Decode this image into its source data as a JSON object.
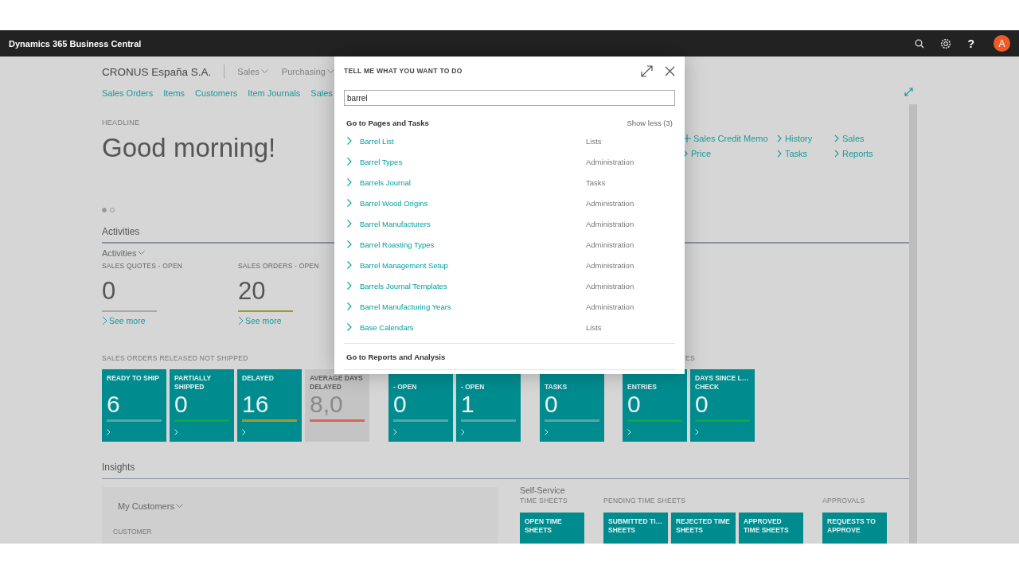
{
  "topbar": {
    "title": "Dynamics 365 Business Central",
    "avatar": "A",
    "help": "?"
  },
  "company": "CRONUS España S.A.",
  "nav_menus": [
    {
      "label": "Sales"
    },
    {
      "label": "Purchasing"
    }
  ],
  "nav_links": [
    "Sales Orders",
    "Items",
    "Customers",
    "Item Journals",
    "Sales"
  ],
  "headline": {
    "label": "HEADLINE",
    "greeting": "Good morning!"
  },
  "actions": [
    {
      "label": "Sales Credit Memo",
      "kind": "new"
    },
    {
      "label": "History",
      "kind": "open"
    },
    {
      "label": "Sales",
      "kind": "open"
    },
    {
      "label": "Price",
      "kind": "open"
    },
    {
      "label": "Tasks",
      "kind": "open"
    },
    {
      "label": "Reports",
      "kind": "open"
    }
  ],
  "pager": [
    {
      "selected": true
    },
    {
      "selected": false
    }
  ],
  "activities": {
    "title": "Activities",
    "dropdown": "Activities",
    "cues": [
      {
        "title": "SALES QUOTES - OPEN",
        "value": "0",
        "link": "See more",
        "color": "#a8a8a8"
      },
      {
        "title": "SALES ORDERS - OPEN",
        "value": "20",
        "link": "See more",
        "color": "#a39a2f"
      }
    ]
  },
  "tile_groups": [
    {
      "heading": "SALES ORDERS RELEASED NOT SHIPPED",
      "tiles": [
        {
          "title": "READY TO SHIP",
          "value": "6",
          "color": "#5aa5a5",
          "kind": "cue"
        },
        {
          "title": "PARTIALLY SHIPPED",
          "value": "0",
          "color": "#17a346",
          "kind": "cue"
        },
        {
          "title": "DELAYED",
          "value": "16",
          "color": "#a39a2f",
          "kind": "cue"
        },
        {
          "title": "AVERAGE DAYS DELAYED",
          "value": "8,0",
          "color": "#d9645a",
          "kind": "muted"
        }
      ]
    },
    {
      "tiles": [
        {
          "title": "- OPEN",
          "value": "0",
          "color": "#5aa5a5",
          "kind": "covered"
        },
        {
          "title": "- OPEN",
          "value": "1",
          "color": "#5aa5a5",
          "kind": "covered"
        }
      ]
    },
    {
      "tiles": [
        {
          "title": "TASKS",
          "value": "0",
          "color": "#5aa5a5",
          "kind": "covered"
        }
      ]
    },
    {
      "heading": "ES",
      "tiles": [
        {
          "title": "ENTRIES",
          "value": "0",
          "color": "#17a346",
          "kind": "covered"
        },
        {
          "title": "DAYS SINCE L… CHECK",
          "value": "0",
          "color": "#17a346",
          "kind": "cue"
        }
      ]
    }
  ],
  "insights": {
    "title": "Insights",
    "customers": {
      "dropdown": "My Customers",
      "column_1": "CUSTOMER"
    },
    "self_service": {
      "title": "Self-Service",
      "groups": [
        {
          "heading": "TIME SHEETS",
          "tiles": [
            "OPEN TIME SHEETS"
          ]
        },
        {
          "heading": "PENDING TIME SHEETS",
          "tiles": [
            "SUBMITTED TI… SHEETS",
            "REJECTED TIME SHEETS",
            "APPROVED TIME SHEETS"
          ]
        },
        {
          "heading": "APPROVALS",
          "tiles": [
            "REQUESTS TO APPROVE"
          ]
        }
      ]
    }
  },
  "dialog": {
    "title": "TELL ME WHAT YOU WANT TO DO",
    "search": {
      "value": "barrel"
    },
    "pages": {
      "heading": "Go to Pages and Tasks",
      "toggle": "Show less (3)",
      "results": [
        {
          "name": "Barrel List",
          "category": "Lists"
        },
        {
          "name": "Barrel Types",
          "category": "Administration"
        },
        {
          "name": "Barrels Journal",
          "category": "Tasks"
        },
        {
          "name": "Barrel Wood Origins",
          "category": "Administration"
        },
        {
          "name": "Barrel Manufacturers",
          "category": "Administration"
        },
        {
          "name": "Barrel Roasting Types",
          "category": "Administration"
        },
        {
          "name": "Barrel Management Setup",
          "category": "Administration"
        },
        {
          "name": "Barrels Journal Templates",
          "category": "Administration"
        },
        {
          "name": "Barrel Manufacturing Years",
          "category": "Administration"
        },
        {
          "name": "Base Calendars",
          "category": "Lists"
        }
      ]
    },
    "reports": {
      "heading": "Go to Reports and Analysis"
    }
  }
}
